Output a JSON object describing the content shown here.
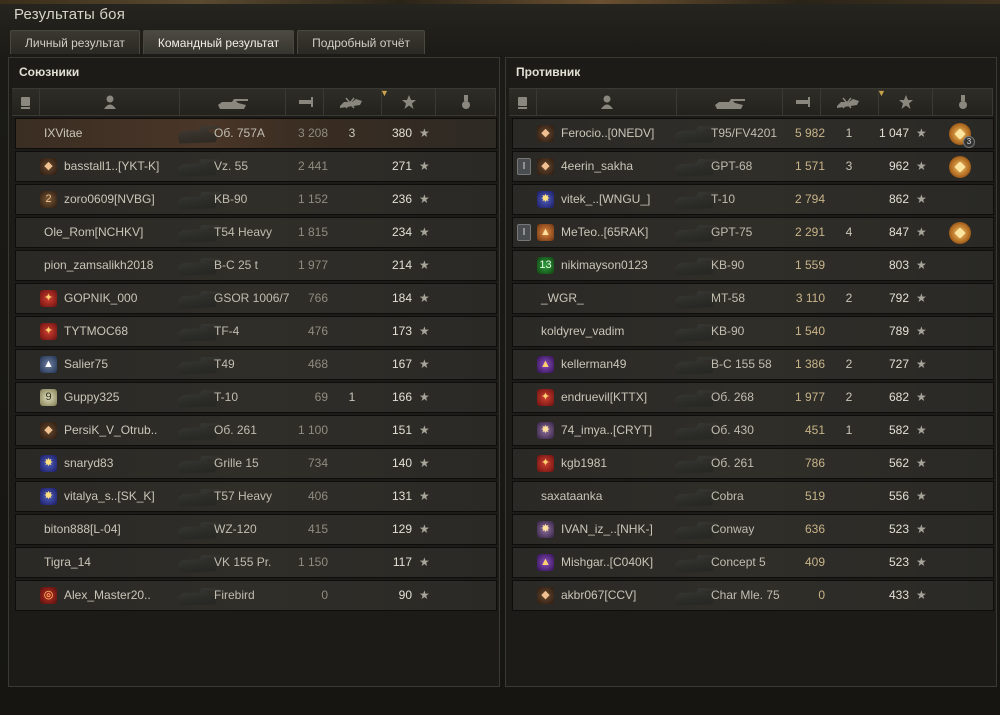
{
  "window": {
    "title": "Результаты боя"
  },
  "tabs": [
    {
      "label": "Личный результат",
      "active": false
    },
    {
      "label": "Командный результат",
      "active": true
    },
    {
      "label": "Подробный отчёт",
      "active": false
    }
  ],
  "colors": {
    "highlight_row": "#4a3628",
    "damage_hot": "#c8b48a",
    "medal_gold": "#f4c56a"
  },
  "header_icons": [
    "sort-icon",
    "player-icon",
    "tank-icon",
    "damage-icon",
    "kills-icon",
    "xp-star-icon",
    "medal-icon"
  ],
  "allies": {
    "title": "Союзники",
    "rows": [
      {
        "player": "IXVitae",
        "tank": "Об. 757А",
        "damage": "3 208",
        "kills": "3",
        "xp": "380",
        "icon": "",
        "highlight": true
      },
      {
        "player": "basstall1..[YKT-K]",
        "tank": "Vz. 55",
        "damage": "2 441",
        "kills": "",
        "xp": "271",
        "icon": "diamond-icon"
      },
      {
        "player": "zoro0609[NVBG]",
        "tank": "KB-90",
        "damage": "1 152",
        "kills": "",
        "xp": "236",
        "icon": "diamond-2-icon"
      },
      {
        "player": "Ole_Rom[NCHKV]",
        "tank": "T54 Heavy",
        "damage": "1 815",
        "kills": "",
        "xp": "234",
        "icon": ""
      },
      {
        "player": "pion_zamsalikh2018",
        "tank": "B-C 25 t",
        "damage": "1 977",
        "kills": "",
        "xp": "214",
        "icon": ""
      },
      {
        "player": "GOPNIK_000",
        "tank": "GSOR 1006/7",
        "damage": "766",
        "kills": "",
        "xp": "184",
        "icon": "red-emblem-icon"
      },
      {
        "player": "TYTMOC68",
        "tank": "TF-4",
        "damage": "476",
        "kills": "",
        "xp": "173",
        "icon": "red-emblem-icon"
      },
      {
        "player": "Salier75",
        "tank": "T49",
        "damage": "468",
        "kills": "",
        "xp": "167",
        "icon": "ship-icon"
      },
      {
        "player": "Guppy325",
        "tank": "T-10",
        "damage": "69",
        "kills": "1",
        "xp": "166",
        "icon": "nine-icon"
      },
      {
        "player": "PersiK_V_Otrub..",
        "tank": "Об. 261",
        "damage": "1 100",
        "kills": "",
        "xp": "151",
        "icon": "diamond-icon"
      },
      {
        "player": "snaryd83",
        "tank": "Grille 15",
        "damage": "734",
        "kills": "",
        "xp": "140",
        "icon": "blue-emblem-icon"
      },
      {
        "player": "vitalya_s..[SK_K]",
        "tank": "T57 Heavy",
        "damage": "406",
        "kills": "",
        "xp": "131",
        "icon": "blue-emblem-icon"
      },
      {
        "player": "biton888[L-04]",
        "tank": "WZ-120",
        "damage": "415",
        "kills": "",
        "xp": "129",
        "icon": ""
      },
      {
        "player": "Tigra_14",
        "tank": "VK 155 Pr.",
        "damage": "1 150",
        "kills": "",
        "xp": "117",
        "icon": ""
      },
      {
        "player": "Alex_Master20..",
        "tank": "Firebird",
        "damage": "0",
        "kills": "",
        "xp": "90",
        "icon": "target-icon"
      }
    ]
  },
  "enemies": {
    "title": "Противник",
    "rows": [
      {
        "squad": "",
        "player": "Ferocio..[0NEDV]",
        "tank": "T95/FV4201",
        "damage": "5 982",
        "kills": "1",
        "xp": "1 047",
        "icon": "diamond-icon",
        "medal": "3"
      },
      {
        "squad": "I",
        "player": "4eerin_sakha",
        "tank": "GPT-68",
        "damage": "1 571",
        "kills": "3",
        "xp": "962",
        "icon": "diamond-icon",
        "medal": ""
      },
      {
        "squad": "",
        "player": "vitek_..[WNGU_]",
        "tank": "T-10",
        "damage": "2 794",
        "kills": "",
        "xp": "862",
        "icon": "blue-emblem-icon"
      },
      {
        "squad": "I",
        "player": "MeTeo..[65RAK]",
        "tank": "GPT-75",
        "damage": "2 291",
        "kills": "4",
        "xp": "847",
        "icon": "orange-emblem-icon",
        "medal": ""
      },
      {
        "squad": "",
        "player": "nikimayson0123",
        "tank": "KB-90",
        "damage": "1 559",
        "kills": "",
        "xp": "803",
        "icon": "thirteen-icon"
      },
      {
        "squad": "",
        "player": "_WGR_",
        "tank": "MT-58",
        "damage": "3 110",
        "kills": "2",
        "xp": "792",
        "icon": ""
      },
      {
        "squad": "",
        "player": "koldyrev_vadim",
        "tank": "KB-90",
        "damage": "1 540",
        "kills": "",
        "xp": "789",
        "icon": ""
      },
      {
        "squad": "",
        "player": "kellerman49",
        "tank": "B-C 155 58",
        "damage": "1 386",
        "kills": "2",
        "xp": "727",
        "icon": "purple-emblem-icon"
      },
      {
        "squad": "",
        "player": "endruevil[KTTX]",
        "tank": "Об. 268",
        "damage": "1 977",
        "kills": "2",
        "xp": "682",
        "icon": "red-emblem-icon"
      },
      {
        "squad": "",
        "player": "74_imya..[CRYT]",
        "tank": "Об. 430",
        "damage": "451",
        "kills": "1",
        "xp": "582",
        "icon": "star-emblem-icon"
      },
      {
        "squad": "",
        "player": "kgb1981",
        "tank": "Об. 261",
        "damage": "786",
        "kills": "",
        "xp": "562",
        "icon": "red-emblem-icon"
      },
      {
        "squad": "",
        "player": "saxataanka",
        "tank": "Cobra",
        "damage": "519",
        "kills": "",
        "xp": "556",
        "icon": ""
      },
      {
        "squad": "",
        "player": "IVAN_iz_..[NHK-]",
        "tank": "Conway",
        "damage": "636",
        "kills": "",
        "xp": "523",
        "icon": "star-emblem-icon"
      },
      {
        "squad": "",
        "player": "Mishgar..[C040K]",
        "tank": "Concept 5",
        "damage": "409",
        "kills": "",
        "xp": "523",
        "icon": "purple-emblem-icon"
      },
      {
        "squad": "",
        "player": "akbr067[CCV]",
        "tank": "Char Mle. 75",
        "damage": "0",
        "kills": "",
        "xp": "433",
        "icon": "diamond-icon"
      }
    ]
  }
}
